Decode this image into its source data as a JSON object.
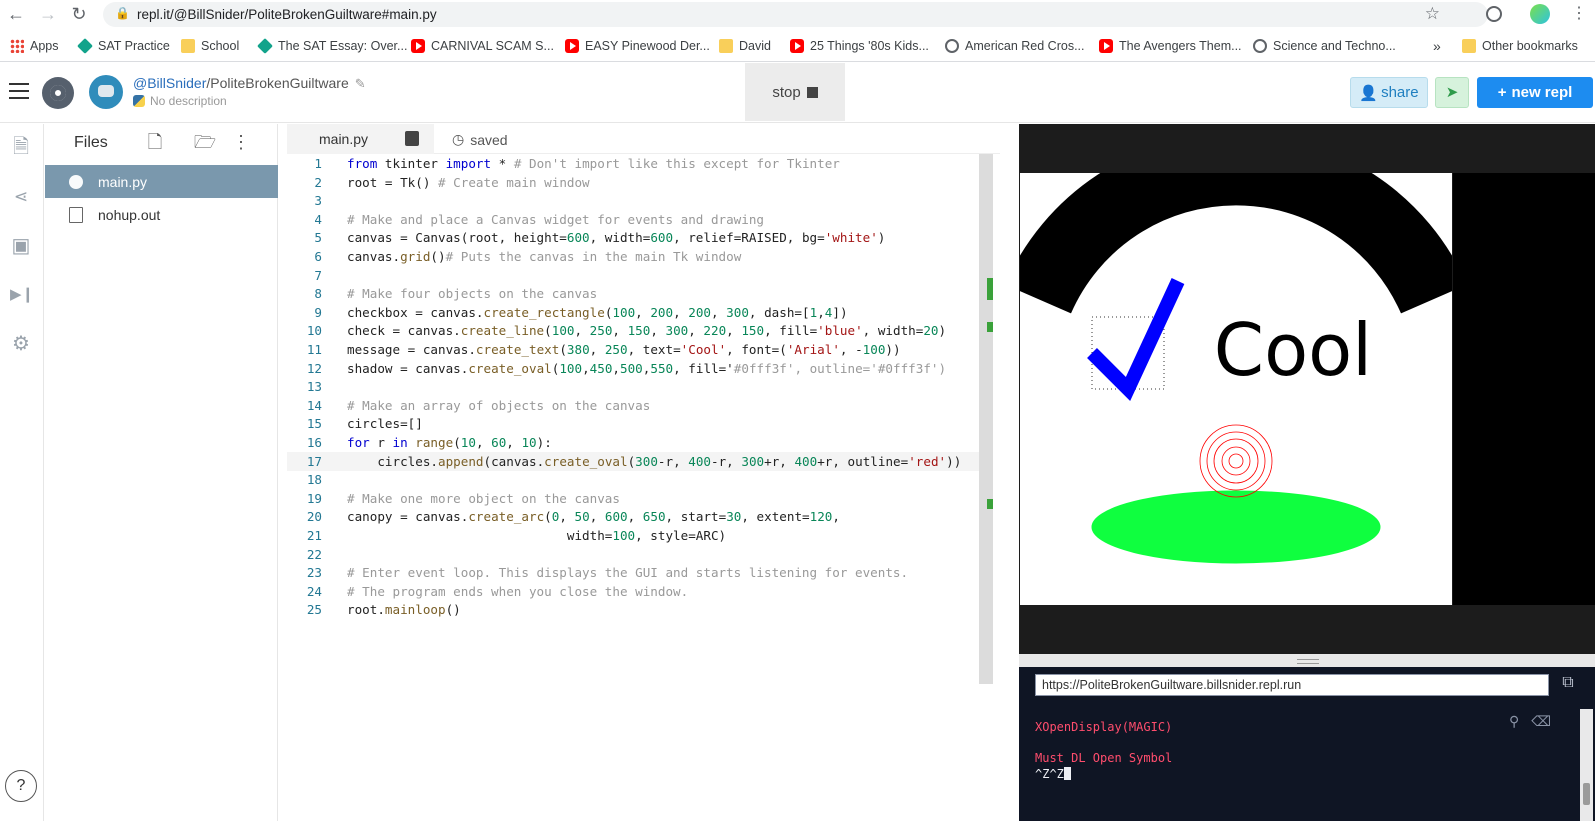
{
  "browser": {
    "url": "repl.it/@BillSnider/PoliteBrokenGuiltware#main.py",
    "bookmarks": [
      {
        "label": "Apps",
        "icon": "apps-icon"
      },
      {
        "label": "SAT Practice",
        "icon": "sat-icon"
      },
      {
        "label": "School",
        "icon": "folder-icon"
      },
      {
        "label": "The SAT Essay: Over...",
        "icon": "sat-icon"
      },
      {
        "label": "CARNIVAL SCAM S...",
        "icon": "youtube-icon"
      },
      {
        "label": "EASY Pinewood Der...",
        "icon": "youtube-icon"
      },
      {
        "label": "David",
        "icon": "folder-icon"
      },
      {
        "label": "25 Things '80s Kids...",
        "icon": "youtube-icon"
      },
      {
        "label": "American Red Cros...",
        "icon": "globe-icon"
      },
      {
        "label": "The Avengers Them...",
        "icon": "youtube-icon"
      },
      {
        "label": "Science and Techno...",
        "icon": "globe-icon"
      }
    ],
    "more_label": "»",
    "other_bookmarks": "Other bookmarks"
  },
  "header": {
    "owner": "@BillSnider",
    "slug": "/PoliteBrokenGuiltware",
    "description": "No description",
    "stop_label": "stop",
    "share_label": "share",
    "new_repl_label": "new repl"
  },
  "files": {
    "title": "Files",
    "items": [
      {
        "name": "main.py",
        "active": true
      },
      {
        "name": "nohup.out",
        "active": false
      }
    ]
  },
  "editor": {
    "tab_name": "main.py",
    "status": "saved",
    "current_line": 17,
    "lines": [
      "from tkinter import * # Don't import like this except for Tkinter",
      "root = Tk() # Create main window",
      "",
      "# Make and place a Canvas widget for events and drawing",
      "canvas = Canvas(root, height=600, width=600, relief=RAISED, bg='white')",
      "canvas.grid()# Puts the canvas in the main Tk window",
      "",
      "# Make four objects on the canvas",
      "checkbox = canvas.create_rectangle(100, 200, 200, 300, dash=[1,4])",
      "check = canvas.create_line(100, 250, 150, 300, 220, 150, fill='blue', width=20)",
      "message = canvas.create_text(380, 250, text='Cool', font=('Arial', -100))",
      "shadow = canvas.create_oval(100,450,500,550, fill='#0fff3f', outline='#0fff3f')",
      "",
      "# Make an array of objects on the canvas",
      "circles=[]",
      "for r in range(10, 60, 10):",
      "    circles.append(canvas.create_oval(300-r, 400-r, 300+r, 400+r, outline='red'))",
      "",
      "# Make one more object on the canvas",
      "canopy = canvas.create_arc(0, 50, 600, 650, start=30, extent=120,",
      "                             width=100, style=ARC)",
      "",
      "# Enter event loop. This displays the GUI and starts listening for events.",
      "# The program ends when you close the window.",
      "root.mainloop()"
    ]
  },
  "output": {
    "canvas_text": "Cool",
    "text_color": "#000000",
    "check_color": "#0000ff",
    "shadow_color": "#0fff3f",
    "circle_color": "#ff0000",
    "arc_color": "#000000"
  },
  "console": {
    "url": "https://PoliteBrokenGuiltware.billsnider.repl.run",
    "lines": [
      "XOpenDisplay(MAGIC)",
      "Must DL Open Symbol",
      "^Z^Z"
    ]
  },
  "colors": {
    "accent": "#1d8cf0",
    "file_active_bg": "#7a98ad",
    "console_bg": "#0f1524",
    "console_error": "#ff4d6d"
  }
}
